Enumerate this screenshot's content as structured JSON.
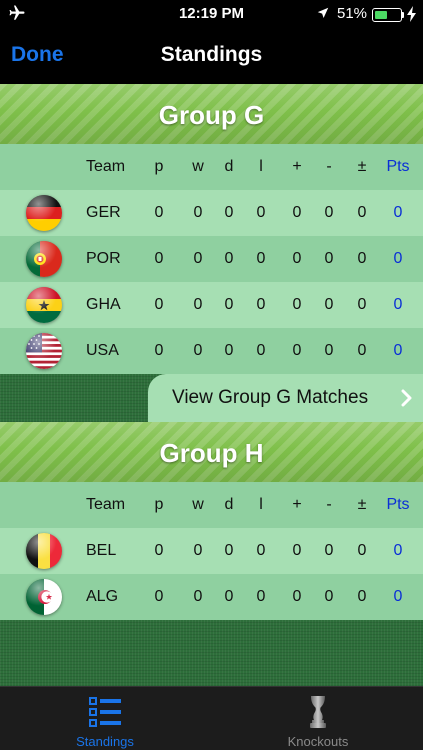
{
  "status_bar": {
    "time": "12:19 PM",
    "battery_percent": "51%",
    "battery_level": 0.51,
    "icons": [
      "airplane-icon",
      "location-arrow-icon",
      "battery-icon",
      "charging-bolt-icon"
    ]
  },
  "nav": {
    "done_label": "Done",
    "title": "Standings"
  },
  "colors": {
    "accent_blue": "#1a74e8",
    "pts_blue": "#0a2fd6",
    "row_light": "#a6dfb3",
    "row_dark": "#8fd0a0",
    "header_green": "#7fc04a"
  },
  "columns": {
    "team": "Team",
    "p": "p",
    "w": "w",
    "d": "d",
    "l": "l",
    "plus": "+",
    "minus": "-",
    "pm": "±",
    "pts": "Pts"
  },
  "groups": [
    {
      "title": "Group G",
      "matches_label": "View Group G Matches",
      "teams": [
        {
          "code": "GER",
          "flag": "germany-flag-icon",
          "p": "0",
          "w": "0",
          "d": "0",
          "l": "0",
          "plus": "0",
          "minus": "0",
          "pm": "0",
          "pts": "0"
        },
        {
          "code": "POR",
          "flag": "portugal-flag-icon",
          "p": "0",
          "w": "0",
          "d": "0",
          "l": "0",
          "plus": "0",
          "minus": "0",
          "pm": "0",
          "pts": "0"
        },
        {
          "code": "GHA",
          "flag": "ghana-flag-icon",
          "p": "0",
          "w": "0",
          "d": "0",
          "l": "0",
          "plus": "0",
          "minus": "0",
          "pm": "0",
          "pts": "0"
        },
        {
          "code": "USA",
          "flag": "usa-flag-icon",
          "p": "0",
          "w": "0",
          "d": "0",
          "l": "0",
          "plus": "0",
          "minus": "0",
          "pm": "0",
          "pts": "0"
        }
      ]
    },
    {
      "title": "Group H",
      "teams": [
        {
          "code": "BEL",
          "flag": "belgium-flag-icon",
          "p": "0",
          "w": "0",
          "d": "0",
          "l": "0",
          "plus": "0",
          "minus": "0",
          "pm": "0",
          "pts": "0"
        },
        {
          "code": "ALG",
          "flag": "algeria-flag-icon",
          "p": "0",
          "w": "0",
          "d": "0",
          "l": "0",
          "plus": "0",
          "minus": "0",
          "pm": "0",
          "pts": "0"
        }
      ]
    }
  ],
  "tabs": [
    {
      "label": "Standings",
      "icon": "list-icon",
      "selected": true
    },
    {
      "label": "Knockouts",
      "icon": "trophy-icon",
      "selected": false
    }
  ]
}
